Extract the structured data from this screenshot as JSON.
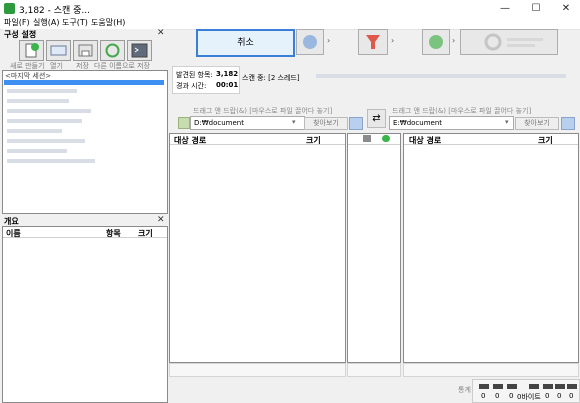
{
  "window": {
    "title": "3,182 - 스캔 중...",
    "minimize": "—",
    "maximize": "☐",
    "close": "✕"
  },
  "menu": [
    "파일(F)",
    "실행(A)",
    "도구(T)",
    "도움말(H)"
  ],
  "config": {
    "header": "구성 설정",
    "toolbar": [
      "새로 만들기",
      "열기",
      "저장",
      "다른 이름으로 저장"
    ],
    "last_session": "<마지막 세션>"
  },
  "overview": {
    "header": "개요",
    "columns": [
      "이름",
      "항목",
      "크기"
    ]
  },
  "actions": {
    "cancel": "취소"
  },
  "scan_info": {
    "found_label": "발견된 항목:",
    "found_value": "3,182",
    "elapsed_label": "경과 시간:",
    "elapsed_value": "00:01",
    "status": "스캔 중: [2 스레드]"
  },
  "left_folder": {
    "drop_hint": "드래그 앤 드랍(&) [마우스로 파일 끌어다 놓기]",
    "path": "D:₩document",
    "browse": "찾아보기"
  },
  "right_folder": {
    "drop_hint": "드래그 앤 드랍(&) [마우스로 파일 끌어다 놓기]",
    "path": "E:₩document",
    "browse": "찾아보기"
  },
  "grid_left": {
    "columns": [
      "대상 경로",
      "크기"
    ]
  },
  "grid_right": {
    "columns": [
      "대상 경로",
      "크기"
    ]
  },
  "stats": {
    "label": "통계",
    "counts": [
      "0",
      "0",
      "0",
      "0바이트",
      "0",
      "0",
      "0"
    ]
  },
  "colors": {
    "accent": "#3a7fd6",
    "selection": "#3d8ff2",
    "icon_green": "#2e9a3e",
    "filter_red": "#e0584b"
  }
}
